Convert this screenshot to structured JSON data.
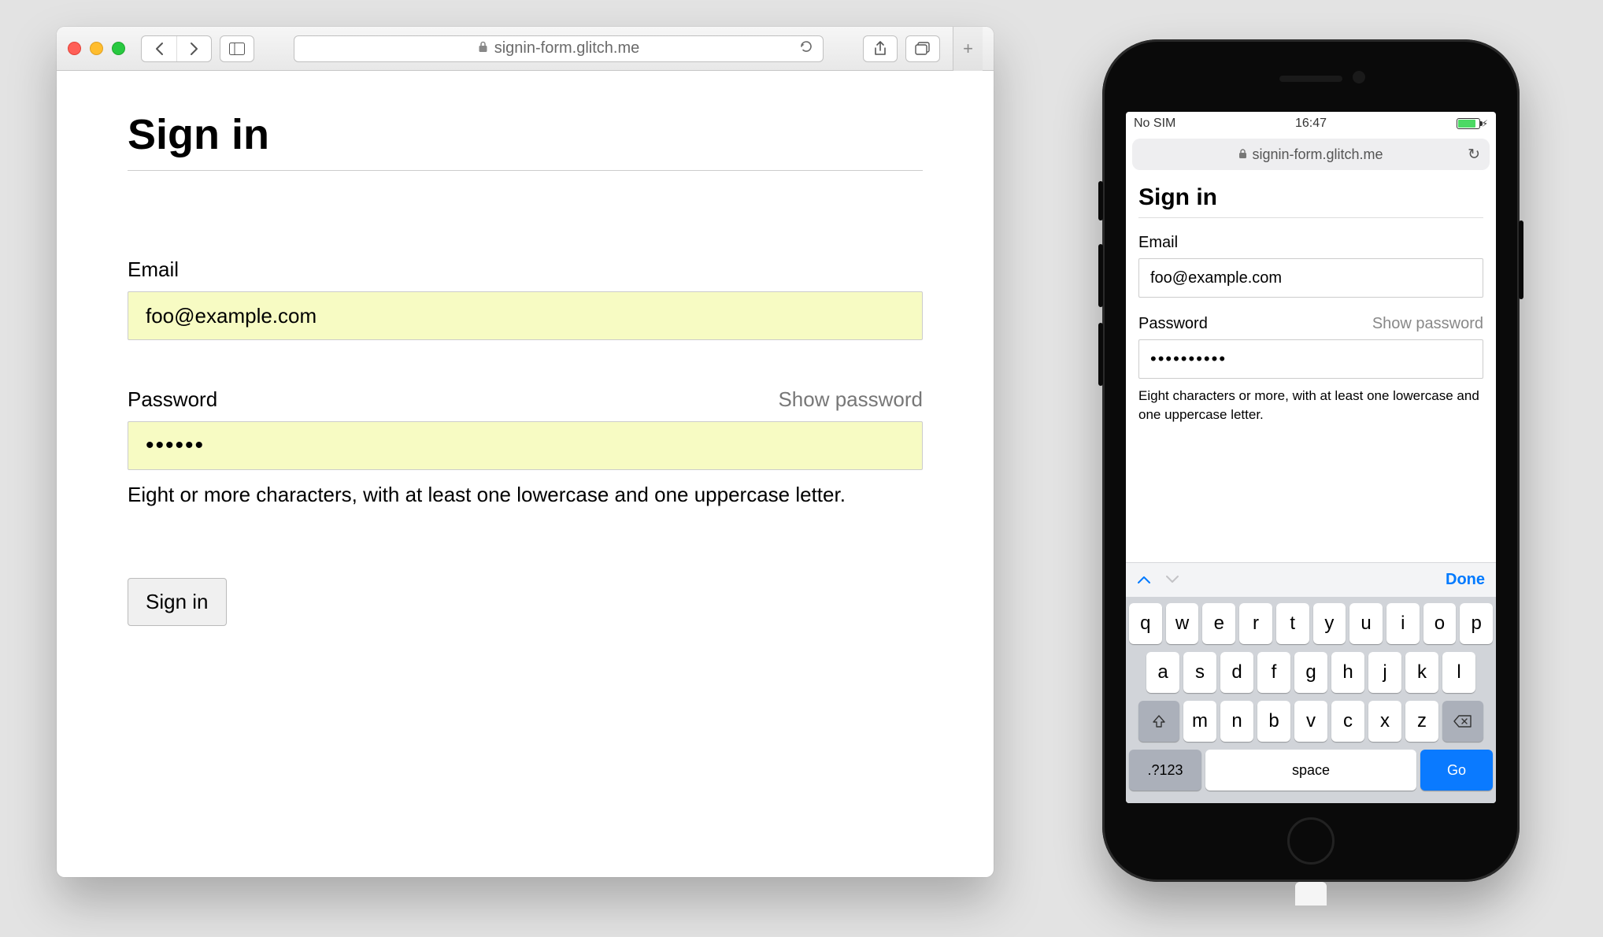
{
  "desktop": {
    "url": "signin-form.glitch.me",
    "form": {
      "title": "Sign in",
      "email_label": "Email",
      "email_value": "foo@example.com",
      "password_label": "Password",
      "show_password": "Show password",
      "password_dots": "••••••",
      "password_hint": "Eight or more characters, with at least one lowercase and one uppercase letter.",
      "submit_label": "Sign in"
    }
  },
  "mobile": {
    "status": {
      "carrier": "No SIM",
      "time": "16:47"
    },
    "url": "signin-form.glitch.me",
    "form": {
      "title": "Sign in",
      "email_label": "Email",
      "email_value": "foo@example.com",
      "password_label": "Password",
      "show_password": "Show password",
      "password_dots": "••••••••••",
      "password_hint": "Eight characters or more, with at least one lowercase and one uppercase letter."
    },
    "keyboard": {
      "done": "Done",
      "row1": [
        "q",
        "w",
        "e",
        "r",
        "t",
        "y",
        "u",
        "i",
        "o",
        "p"
      ],
      "row2": [
        "a",
        "s",
        "d",
        "f",
        "g",
        "h",
        "j",
        "k",
        "l"
      ],
      "row3": [
        "z",
        "x",
        "c",
        "v",
        "b",
        "n",
        "m"
      ],
      "numbers_key": ".?123",
      "space_key": "space",
      "go_key": "Go"
    }
  }
}
